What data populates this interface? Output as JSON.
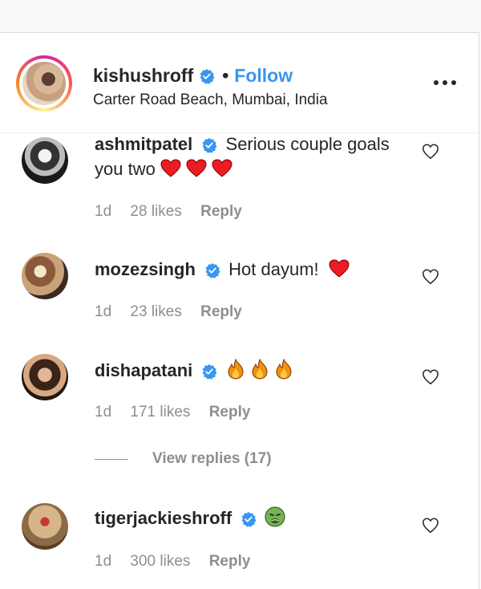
{
  "post_header": {
    "username": "kishushroff",
    "separator": "•",
    "follow_label": "Follow",
    "location": "Carter Road Beach, Mumbai, India",
    "more_label": "•••"
  },
  "comments": [
    {
      "username": "ashmitpatel",
      "text": "Serious couple goals you two",
      "emoji": [
        "red-heart",
        "red-heart",
        "red-heart"
      ],
      "age": "1d",
      "likes": "28 likes",
      "reply_label": "Reply"
    },
    {
      "username": "mozezsingh",
      "text": "Hot dayum!",
      "emoji": [
        "red-heart"
      ],
      "age": "1d",
      "likes": "23 likes",
      "reply_label": "Reply"
    },
    {
      "username": "dishapatani",
      "text": "",
      "emoji": [
        "fire",
        "fire",
        "fire"
      ],
      "age": "1d",
      "likes": "171 likes",
      "reply_label": "Reply"
    },
    {
      "username": "tigerjackieshroff",
      "text": "",
      "emoji": [
        "nauseated-face"
      ],
      "age": "1d",
      "likes": "300 likes",
      "reply_label": "Reply"
    }
  ],
  "view_replies": "View replies (17)",
  "colors": {
    "link_blue": "#3897f0",
    "verified_blue": "#3897f0",
    "text_primary": "#262626",
    "text_secondary": "#8e8e8e",
    "heart_red": "#ed1c24"
  },
  "icons": [
    "verified-badge-icon",
    "heart-outline-icon",
    "more-options-icon",
    "red-heart-emoji",
    "fire-emoji",
    "nauseated-face-emoji"
  ]
}
